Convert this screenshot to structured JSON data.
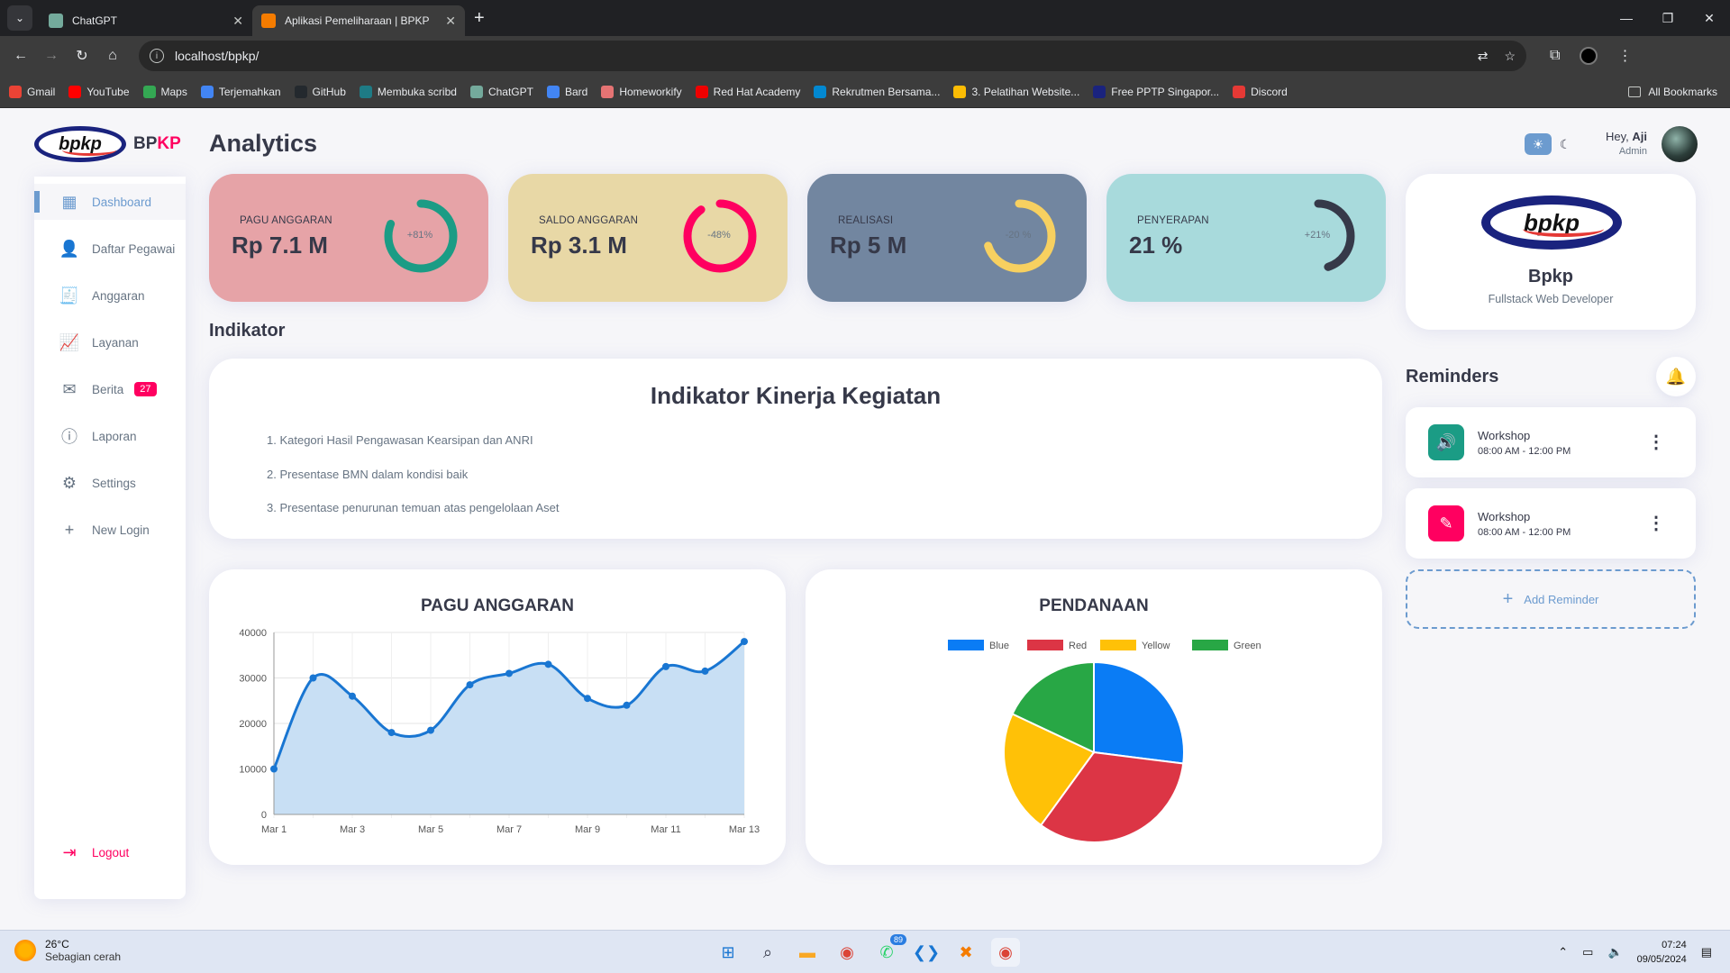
{
  "browser": {
    "tabs": [
      {
        "title": "ChatGPT",
        "active": false,
        "favicon_color": "#74aa9c"
      },
      {
        "title": "Aplikasi Pemeliharaan | BPKP",
        "active": true,
        "favicon_color": "#f57c00"
      }
    ],
    "url": "localhost/bpkp/",
    "bookmarks": [
      {
        "label": "Gmail",
        "color": "#ea4335"
      },
      {
        "label": "YouTube",
        "color": "#ff0000"
      },
      {
        "label": "Maps",
        "color": "#34a853"
      },
      {
        "label": "Terjemahkan",
        "color": "#4285f4"
      },
      {
        "label": "GitHub",
        "color": "#24292e"
      },
      {
        "label": "Membuka scribd",
        "color": "#1e7b85"
      },
      {
        "label": "ChatGPT",
        "color": "#74aa9c"
      },
      {
        "label": "Bard",
        "color": "#4285f4"
      },
      {
        "label": "Homeworkify",
        "color": "#e57373"
      },
      {
        "label": "Red Hat Academy",
        "color": "#ee0000"
      },
      {
        "label": "Rekrutmen Bersama...",
        "color": "#0288d1"
      },
      {
        "label": "3. Pelatihan Website...",
        "color": "#fbbc04"
      },
      {
        "label": "Free PPTP Singapor...",
        "color": "#1a237e"
      },
      {
        "label": "Discord",
        "color": "#e53935"
      }
    ],
    "all_bookmarks": "All Bookmarks"
  },
  "app": {
    "logo_text": "bpkp",
    "brand_part1": "BP",
    "brand_part2": "KP",
    "page_title": "Analytics",
    "sidebar": [
      {
        "label": "Dashboard",
        "icon": "grid-icon",
        "glyph": "▦",
        "active": true
      },
      {
        "label": "Daftar Pegawai",
        "icon": "person-icon",
        "glyph": "👤"
      },
      {
        "label": "Anggaran",
        "icon": "receipt-icon",
        "glyph": "🧾"
      },
      {
        "label": "Layanan",
        "icon": "insights-icon",
        "glyph": "📈"
      },
      {
        "label": "Berita",
        "icon": "mail-icon",
        "glyph": "✉",
        "badge": "27"
      },
      {
        "label": "Laporan",
        "icon": "report-icon",
        "glyph": "ⓘ"
      },
      {
        "label": "Settings",
        "icon": "gear-icon",
        "glyph": "⚙"
      },
      {
        "label": "New Login",
        "icon": "add-icon",
        "glyph": "+"
      }
    ],
    "logout": "Logout",
    "cards": [
      {
        "label": "PAGU ANGGARAN",
        "value": "Rp 7.1 M",
        "pct": "+81%",
        "color": "#e6a3a7",
        "ring": "#1b9c85",
        "fraction": 0.81
      },
      {
        "label": "SALDO ANGGARAN",
        "value": "Rp 3.1 M",
        "pct": "-48%",
        "color": "#e8d8a6",
        "ring": "#ff0060",
        "fraction": 0.9
      },
      {
        "label": "REALISASI",
        "value": "Rp 5 M",
        "pct": "-20 %",
        "color": "#7286a0",
        "ring": "#f7d060",
        "fraction": 0.7
      },
      {
        "label": "PENYERAPAN",
        "value": "21 %",
        "pct": "+21%",
        "color": "#a8dadc",
        "ring": "#363949",
        "fraction": 0.45
      }
    ],
    "indikator_section": "Indikator",
    "indikator": {
      "title": "Indikator Kinerja Kegiatan",
      "items": [
        "1. Kategori Hasil Pengawasan Kearsipan dan ANRI",
        "2. Presentase BMN dalam kondisi baik",
        "3. Presentase penurunan temuan atas pengelolaan Aset"
      ]
    },
    "header": {
      "hey": "Hey, ",
      "name": "Aji",
      "role": "Admin",
      "sun": "☀",
      "moon": "☾"
    },
    "profile": {
      "name": "Bpkp",
      "role": "Fullstack Web Developer"
    },
    "reminders_title": "Reminders",
    "reminders": [
      {
        "title": "Workshop",
        "time": "08:00 AM - 12:00 PM",
        "icon": "volume-icon",
        "glyph": "🔊",
        "color": "#1b9c85"
      },
      {
        "title": "Workshop",
        "time": "08:00 AM - 12:00 PM",
        "icon": "edit-icon",
        "glyph": "✎",
        "color": "#ff0060"
      }
    ],
    "add_reminder": "Add Reminder"
  },
  "chart_data": [
    {
      "type": "area",
      "title": "PAGU ANGGARAN",
      "x": [
        "Mar 1",
        "Mar 2",
        "Mar 3",
        "Mar 4",
        "Mar 5",
        "Mar 6",
        "Mar 7",
        "Mar 8",
        "Mar 9",
        "Mar 10",
        "Mar 11",
        "Mar 12",
        "Mar 13"
      ],
      "xticks": [
        "Mar 1",
        "Mar 3",
        "Mar 5",
        "Mar 7",
        "Mar 9",
        "Mar 11",
        "Mar 13"
      ],
      "values": [
        10000,
        30000,
        26000,
        18000,
        18500,
        28500,
        31000,
        33000,
        25500,
        24000,
        32500,
        31500,
        38000
      ],
      "yticks": [
        0,
        10000,
        20000,
        30000,
        40000
      ],
      "ylim": [
        0,
        40000
      ],
      "line_color": "#1976d2",
      "fill_color": "#c8dff4",
      "grid": true
    },
    {
      "type": "pie",
      "title": "PENDANAAN",
      "legend_position": "top",
      "series": [
        {
          "name": "Blue",
          "value": 27,
          "color": "#0a7cf5"
        },
        {
          "name": "Red",
          "value": 33,
          "color": "#dc3545"
        },
        {
          "name": "Yellow",
          "value": 22,
          "color": "#ffc107"
        },
        {
          "name": "Green",
          "value": 18,
          "color": "#28a745"
        }
      ]
    }
  ],
  "taskbar": {
    "temp": "26°C",
    "weather": "Sebagian cerah",
    "time": "07:24",
    "date": "09/05/2024",
    "whatsapp_badge": "89"
  }
}
